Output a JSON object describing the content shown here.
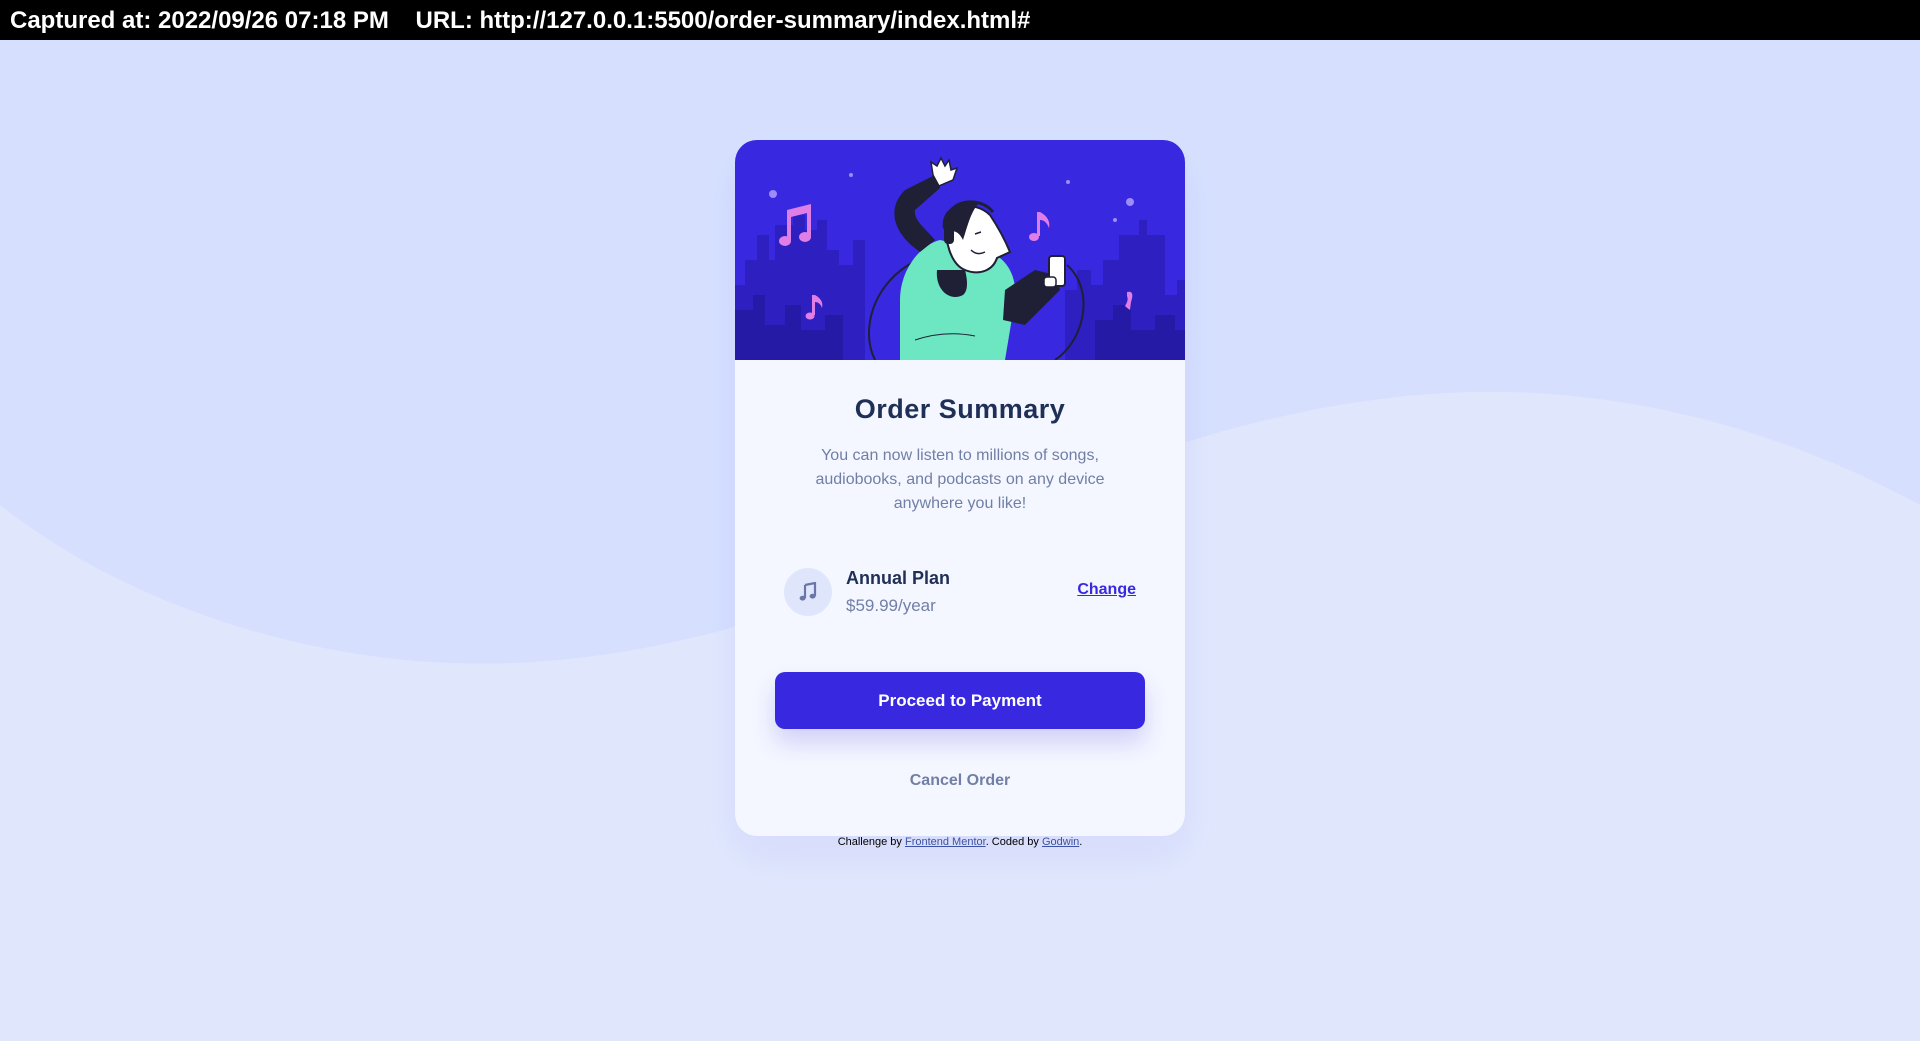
{
  "capture_bar": {
    "captured_label": "Captured at: 2022/09/26 07:18 PM",
    "url_label": "URL: http://127.0.0.1:5500/order-summary/index.html#"
  },
  "colors": {
    "page_background": "#e0e7fd",
    "wave": "#d6e0fe",
    "card_background": "#f4f7ff",
    "hero_background": "#3829e0",
    "primary": "#3829e0",
    "dark_text": "#1f2f56",
    "muted_text": "#717fa6"
  },
  "card": {
    "hero_image": "illustration-hero",
    "title": "Order Summary",
    "description": "You can now listen to millions of songs, audiobooks, and podcasts on any device anywhere you like!",
    "plan": {
      "icon": "music-note-icon",
      "name": "Annual Plan",
      "price": "$59.99/year",
      "change_label": "Change"
    },
    "pay_button_label": "Proceed to Payment",
    "cancel_button_label": "Cancel Order"
  },
  "attribution": {
    "prefix": "Challenge by ",
    "frontend_mentor_link": "Frontend Mentor",
    "middle": ". Coded by ",
    "author_link": "Godwin",
    "suffix": "."
  }
}
